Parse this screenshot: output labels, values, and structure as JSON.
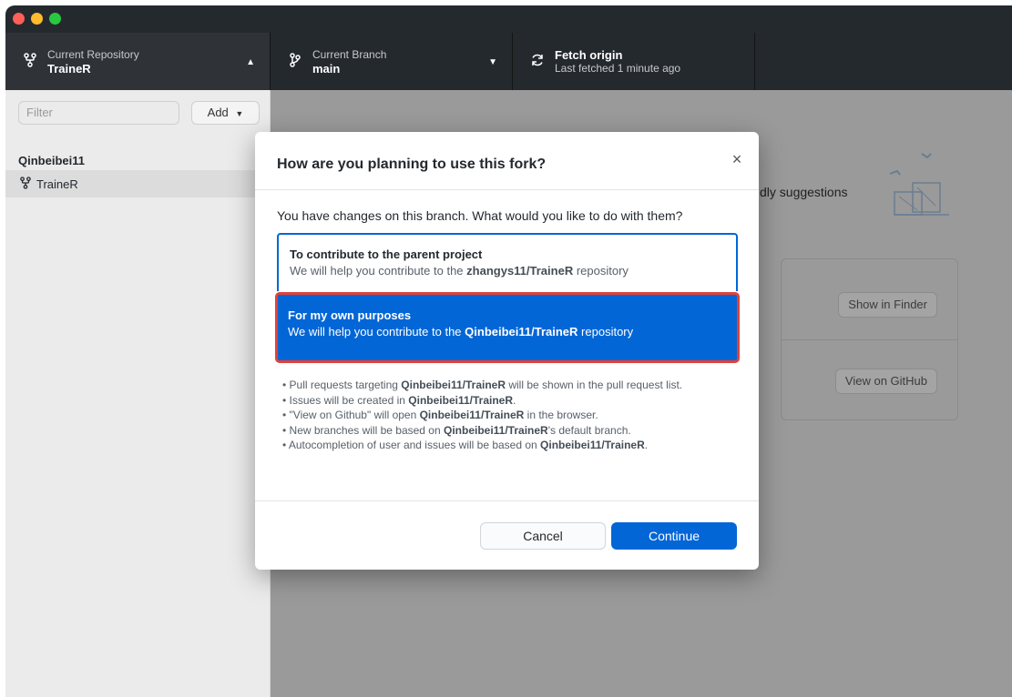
{
  "toolbar": {
    "repo": {
      "label": "Current Repository",
      "value": "TraineR"
    },
    "branch": {
      "label": "Current Branch",
      "value": "main"
    },
    "fetch": {
      "label": "Fetch origin",
      "sub": "Last fetched 1 minute ago"
    }
  },
  "sidebar": {
    "filter_placeholder": "Filter",
    "add_label": "Add",
    "group": "Qinbeibei11",
    "repos": [
      {
        "name": "TraineR",
        "selected": true
      }
    ]
  },
  "main": {
    "partial_text": "dly suggestions",
    "show_in_finder": "Show in Finder",
    "view_on_github": "View on GitHub"
  },
  "dialog": {
    "title": "How are you planning to use this fork?",
    "close_icon": "×",
    "question": "You have changes on this branch. What would you like to do with them?",
    "options": [
      {
        "title": "To contribute to the parent project",
        "desc_prefix": "We will help you contribute to the ",
        "repo": "zhangys11/TraineR",
        "desc_suffix": " repository",
        "selected": false
      },
      {
        "title": "For my own purposes",
        "desc_prefix": "We will help you contribute to the ",
        "repo": "Qinbeibei11/TraineR",
        "desc_suffix": " repository",
        "selected": true
      }
    ],
    "bullets": [
      {
        "pre": "Pull requests targeting ",
        "bold": "Qinbeibei11/TraineR",
        "post": " will be shown in the pull request list."
      },
      {
        "pre": "Issues will be created in ",
        "bold": "Qinbeibei11/TraineR",
        "post": "."
      },
      {
        "pre": "\"View on Github\" will open ",
        "bold": "Qinbeibei11/TraineR",
        "post": " in the browser."
      },
      {
        "pre": "New branches will be based on ",
        "bold": "Qinbeibei11/TraineR",
        "post": "'s default branch."
      },
      {
        "pre": "Autocompletion of user and issues will be based on ",
        "bold": "Qinbeibei11/TraineR",
        "post": "."
      }
    ],
    "cancel_label": "Cancel",
    "continue_label": "Continue"
  },
  "colors": {
    "accent": "#0366d6",
    "highlight_outline": "#e0413a",
    "toolbar": "#24292e"
  },
  "icons": {
    "repo": "repo-forked-icon",
    "branch": "git-branch-icon",
    "fetch": "sync-icon",
    "caret": "chevron-down-icon"
  }
}
